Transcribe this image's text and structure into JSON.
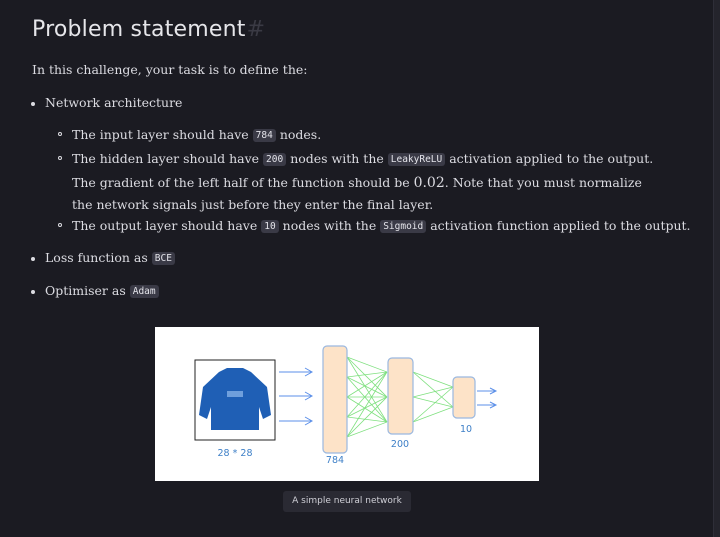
{
  "heading": {
    "title": "Problem statement",
    "anchor": "#"
  },
  "intro": "In this challenge, your task is to define the:",
  "network": {
    "label": "Network architecture",
    "input": {
      "pre": "The input layer should have ",
      "code": "784",
      "post": " nodes."
    },
    "hidden": {
      "pre": "The hidden layer should have ",
      "code1": "200",
      "mid1": " nodes with the ",
      "code2": "LeakyReLU",
      "mid2": " activation applied to the output. The gradient of the left half of the function should be ",
      "value": "0.02",
      "post": ". Note that you must normalize the network signals just before they enter the final layer."
    },
    "output": {
      "pre": "The output layer should have ",
      "code1": "10",
      "mid": " nodes with the ",
      "code2": "Sigmoid",
      "post": " activation function applied to the output."
    }
  },
  "loss": {
    "pre": "Loss function as ",
    "code": "BCE"
  },
  "optimiser": {
    "pre": "Optimiser as ",
    "code": "Adam"
  },
  "figure": {
    "input_label": "28 * 28",
    "layer1_label": "784",
    "layer2_label": "200",
    "layer3_label": "10",
    "caption": "A simple neural network"
  },
  "colors": {
    "background": "#1b1b22",
    "code_bg": "#3a3a46",
    "layer_fill": "#fde3c8",
    "layer_stroke": "#9ab8e0",
    "connection": "#7fe07f",
    "arrow": "#5b8fe8",
    "label": "#3d7fc7",
    "sweater": "#1f5fb5"
  }
}
